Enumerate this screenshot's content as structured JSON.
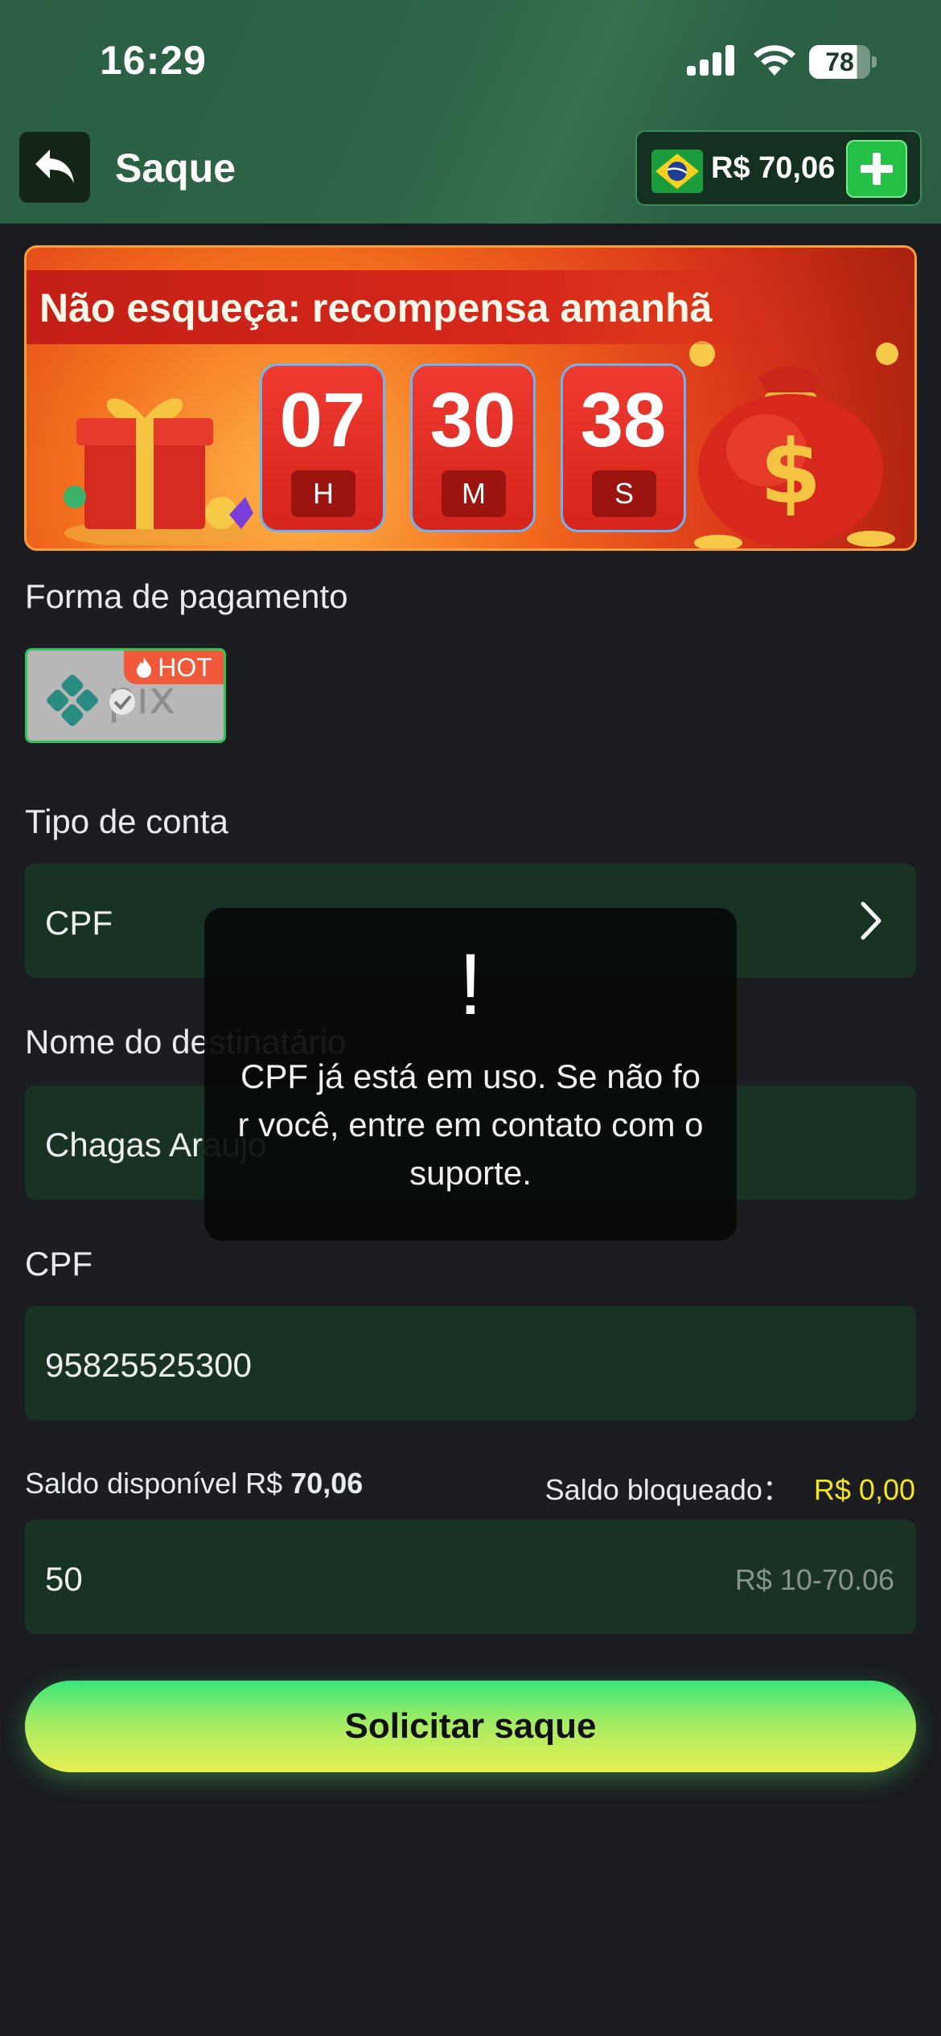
{
  "status_bar": {
    "time": "16:29",
    "battery": "78"
  },
  "header": {
    "title": "Saque",
    "balance": "R$ 70,06"
  },
  "banner": {
    "text": "Não esqueça: recompensa amanhã",
    "countdown": [
      {
        "value": "07",
        "unit": "H"
      },
      {
        "value": "30",
        "unit": "M"
      },
      {
        "value": "38",
        "unit": "S"
      }
    ]
  },
  "payment": {
    "label": "Forma de pagamento",
    "method_badge": "HOT"
  },
  "account_type": {
    "label": "Tipo de conta",
    "value": "CPF"
  },
  "recipient": {
    "label": "Nome do destinatário",
    "value": "Chagas Araujo"
  },
  "cpf": {
    "label": "CPF",
    "value": "95825525300"
  },
  "saldo": {
    "available_label": "Saldo disponível R$",
    "available_value": "70,06",
    "blocked_label": "Saldo bloqueado：",
    "blocked_value": "R$ 0,00"
  },
  "amount": {
    "value": "50",
    "range_hint": "R$ 10-70.06"
  },
  "submit_label": "Solicitar saque",
  "toast": {
    "icon": "!",
    "message": "CPF já está em uso. Se não for você, entre em contato com o suporte."
  },
  "colors": {
    "accent_green": "#25c046",
    "header_bg": "#2b5e44",
    "field_bg": "#183224",
    "yellow": "#f5e51f"
  }
}
